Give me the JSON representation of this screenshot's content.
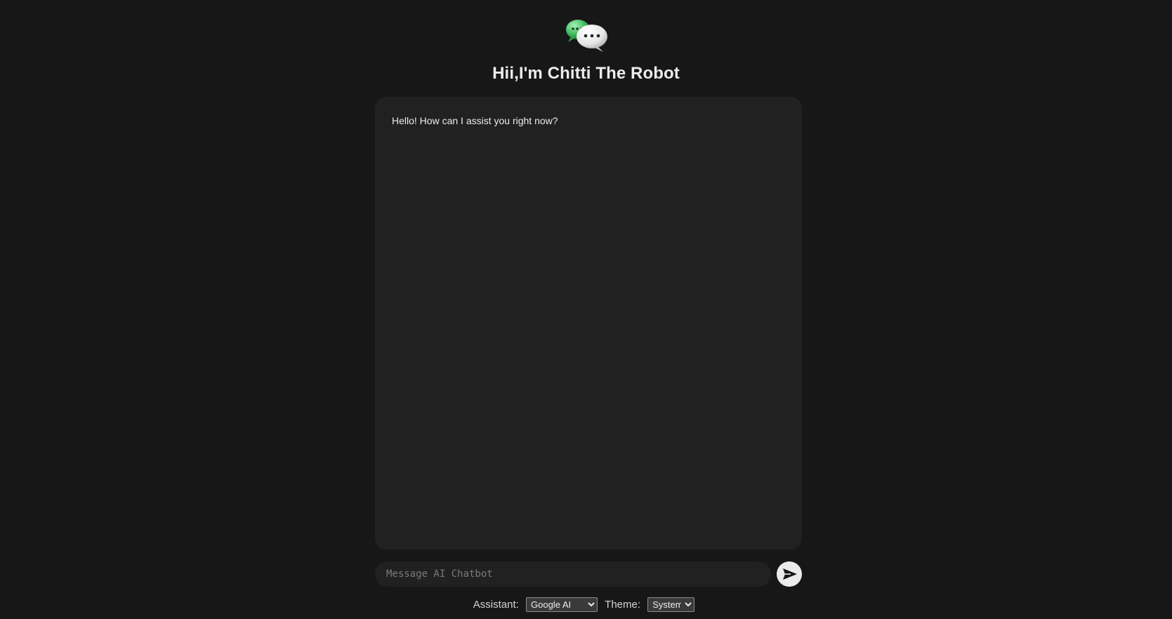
{
  "header": {
    "logo_icon": "chat-bubbles-icon",
    "title": "Hii,I'm Chitti The Robot"
  },
  "chat": {
    "messages": [
      {
        "role": "assistant",
        "text": "Hello! How can I assist you right now?"
      }
    ]
  },
  "composer": {
    "placeholder": "Message AI Chatbot",
    "value": "",
    "send_icon": "send-arrow-icon"
  },
  "settings": {
    "assistant_label": "Assistant:",
    "assistant_value": "Google AI",
    "theme_label": "Theme:",
    "theme_value": "System"
  },
  "colors": {
    "background": "#171717",
    "panel": "#212121",
    "text": "#ececec",
    "send_button": "#ececec",
    "logo_green": "#3dbb5c",
    "logo_white": "#f2f2f2"
  }
}
